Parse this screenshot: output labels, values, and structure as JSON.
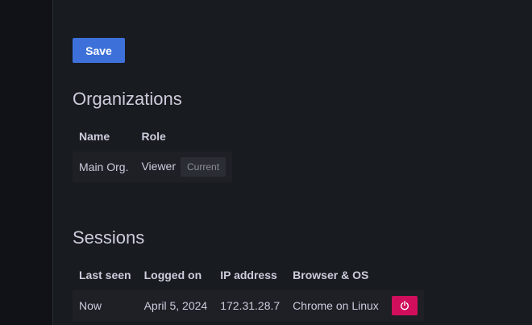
{
  "actions": {
    "save_label": "Save"
  },
  "organizations": {
    "title": "Organizations",
    "columns": [
      "Name",
      "Role"
    ],
    "rows": [
      {
        "name": "Main Org.",
        "role": "Viewer",
        "badge": "Current"
      }
    ]
  },
  "sessions": {
    "title": "Sessions",
    "columns": [
      "Last seen",
      "Logged on",
      "IP address",
      "Browser & OS"
    ],
    "rows": [
      {
        "last_seen": "Now",
        "logged_on": "April 5, 2024",
        "ip": "172.31.28.7",
        "browser": "Chrome on Linux",
        "revoke_icon": "power-icon"
      }
    ]
  },
  "colors": {
    "background": "#181b1f",
    "sidenav": "#111217",
    "primary": "#3d71d9",
    "destructive": "#d10e5c"
  }
}
